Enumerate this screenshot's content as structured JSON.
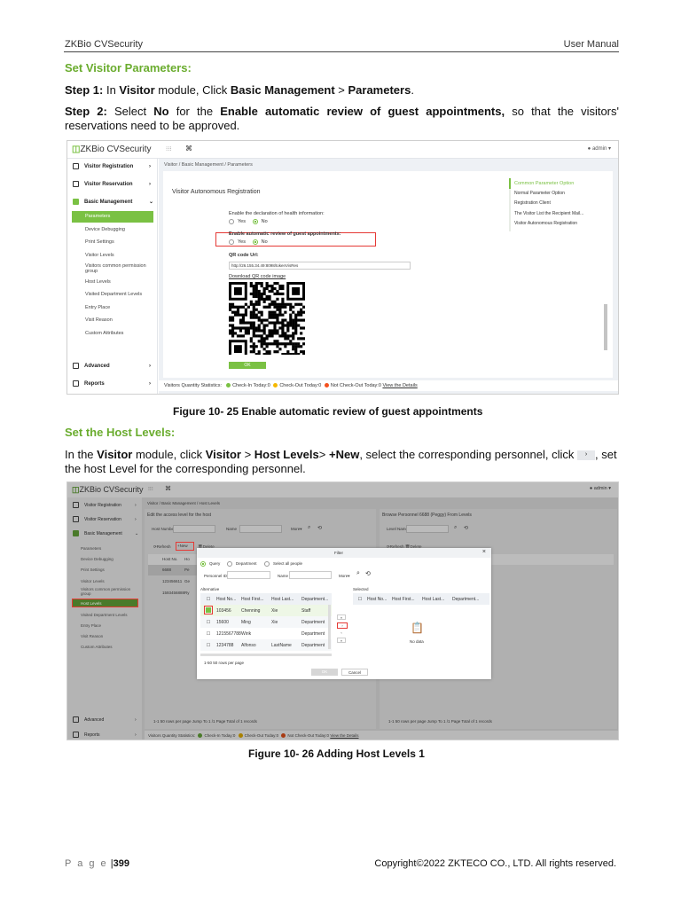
{
  "header": {
    "left": "ZKBio CVSecurity",
    "right": "User Manual"
  },
  "section1": {
    "title": "Set Visitor Parameters:",
    "step1": {
      "label": "Step 1:",
      "t1": " In ",
      "b1": "Visitor",
      "t2": " module, Click ",
      "b2": "Basic Management",
      "t3": " > ",
      "b3": "Parameters",
      "t4": "."
    },
    "step2": {
      "label": "Step 2:",
      "t1": " Select ",
      "b1": "No",
      "t2": " for the ",
      "b2": "Enable automatic review of guest appointments,",
      "t3": " so that the visitors' reservations need to be approved."
    },
    "caption": "Figure 10- 25 Enable automatic review of guest appointments"
  },
  "shot1": {
    "logo": "ZKBio CVSecurity",
    "grid_icon": "grid-icon",
    "user": "admin",
    "sidebar": {
      "visitor_registration": "Visitor Registration",
      "visitor_reservation": "Visitor Reservation",
      "basic_management": "Basic Management",
      "subitems": [
        "Parameters",
        "Device Debugging",
        "Print Settings",
        "Visitor Levels",
        "Visitors common permission group",
        "Host Levels",
        "Visited Department Levels",
        "Entry Place",
        "Visit Reason",
        "Custom Attributes"
      ],
      "advanced": "Advanced",
      "reports": "Reports"
    },
    "breadcrumb": "Visitor / Basic Management / Parameters",
    "section_title": "Visitor Autonomous Registration",
    "health_label": "Enable the declaration of health information:",
    "review_label": "Enable automatic review of guest appointments:",
    "yes": "Yes",
    "no": "No",
    "qr_label": "QR code Url:",
    "qr_url": "http://26.155.34.49:8098/tokenVisRes",
    "download": "Download QR code image",
    "ok": "OK",
    "right_nav": [
      "Common Parameter Option",
      "Normal Parameter Option",
      "Registration Client",
      "The Visitor List the Recipient Mail...",
      "Visitor Autonomous Registration"
    ],
    "status": {
      "label": "Visitors Quantity Statistics:",
      "checkin": "Check-In Today:0",
      "checkout": "Check-Out Today:0",
      "notcheckout": "Not Check-Out Today:0",
      "link": "View the Details"
    }
  },
  "section2": {
    "title": "Set the Host Levels:",
    "p": {
      "t1": "In the ",
      "b1": "Visitor",
      "t2": " module, click ",
      "b2": "Visitor",
      "t3": " > ",
      "b3": "Host Levels",
      "t4": "> ",
      "b4": "+New",
      "t5": ", select the corresponding personnel, click ",
      "t6": ", set the host Level for the corresponding personnel."
    },
    "caption": "Figure 10- 26 Adding Host Levels 1"
  },
  "shot2": {
    "breadcrumb": "Visitor / Basic Management / Host Levels",
    "left_title": "Edit the access level for the host",
    "host_number": "Host Number",
    "name": "Name",
    "more": "More",
    "refresh": "Refresh",
    "new": "+New",
    "delete": "Delete",
    "left_rows": [
      [
        "Host No.",
        "Ho"
      ],
      [
        "6688",
        "Pe"
      ],
      [
        "123456611",
        "Ge"
      ],
      [
        "1593456888",
        "Ry"
      ]
    ],
    "left_pager": "1-1   50 rows per page   Jump To  1   /1 Page   Total of 1 records",
    "right_title": "Browse Personnel 6688 (Peggy) From Levels",
    "level_name": "Level Name",
    "right_pager": "1-1   50 rows per page   Jump To  1   /1 Page   Total of 1 records",
    "dialog": {
      "title": "Filter",
      "radios": [
        "Query",
        "Department",
        "Select all people"
      ],
      "personnel_id": "Personnel ID",
      "name": "Name",
      "more": "More",
      "alternative": "Alternative",
      "selected": "Selected",
      "columns": [
        "Host No...",
        "Host First...",
        "Host Last...",
        "Department..."
      ],
      "rows": [
        [
          "103456",
          "Chenning",
          "Xie",
          "Staff"
        ],
        [
          "15600",
          "Ming",
          "Xie",
          "Department"
        ],
        [
          "1215567788",
          "Wirik",
          "",
          "Department"
        ],
        [
          "1234788",
          "Alfonso",
          "LastName",
          "Department"
        ]
      ],
      "pager": "1-50   50 rows per page",
      "no_data": "No data",
      "ok": "OK",
      "cancel": "Cancel"
    }
  },
  "footer": {
    "page_label": "P a g e",
    "page_number": "399",
    "copyright": "Copyright©2022 ZKTECO CO., LTD.  All rights reserved."
  },
  "colors": {
    "accent": "#6aac2e",
    "highlight": "#e53935"
  }
}
